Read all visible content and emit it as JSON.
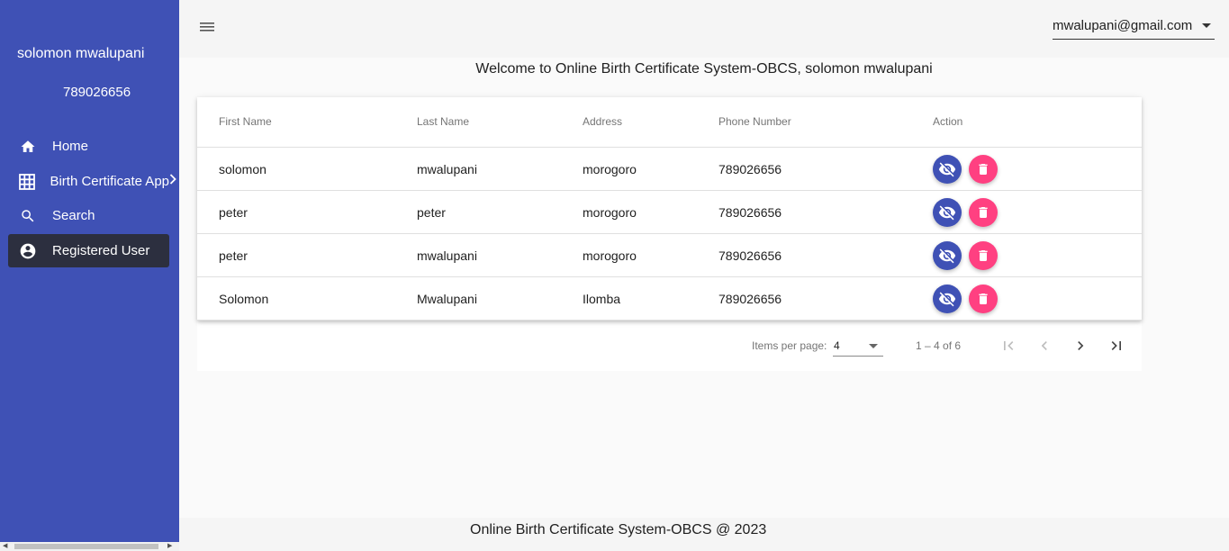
{
  "sidebar": {
    "user_name": "solomon mwalupani",
    "user_phone": "789026656",
    "items": [
      {
        "label": "Home",
        "icon": "home-icon"
      },
      {
        "label": "Birth Certificate App",
        "icon": "grid-icon"
      },
      {
        "label": "Search",
        "icon": "search-icon"
      },
      {
        "label": "Registered User",
        "icon": "account-circle-icon"
      }
    ],
    "active_item": "Registered User"
  },
  "header": {
    "account_email": "mwalupani@gmail.com"
  },
  "welcome": "Welcome to Online Birth Certificate System-OBCS, solomon mwalupani",
  "table": {
    "columns": [
      "First Name",
      "Last Name",
      "Address",
      "Phone Number",
      "Action"
    ],
    "rows": [
      [
        "solomon",
        "mwalupani",
        "morogoro",
        "789026656"
      ],
      [
        "peter",
        "peter",
        "morogoro",
        "789026656"
      ],
      [
        "peter",
        "mwalupani",
        "morogoro",
        "789026656"
      ],
      [
        "Solomon",
        "Mwalupani",
        "Ilomba",
        "789026656"
      ]
    ]
  },
  "paginator": {
    "items_per_page_label": "Items per page:",
    "items_per_page_value": "4",
    "range": "1 – 4 of 6"
  },
  "footer": "Online Birth Certificate System-OBCS @ 2023",
  "colors": {
    "primary": "#3f51b5",
    "accent": "#ff4081",
    "active_nav": "#2c2f3f"
  }
}
